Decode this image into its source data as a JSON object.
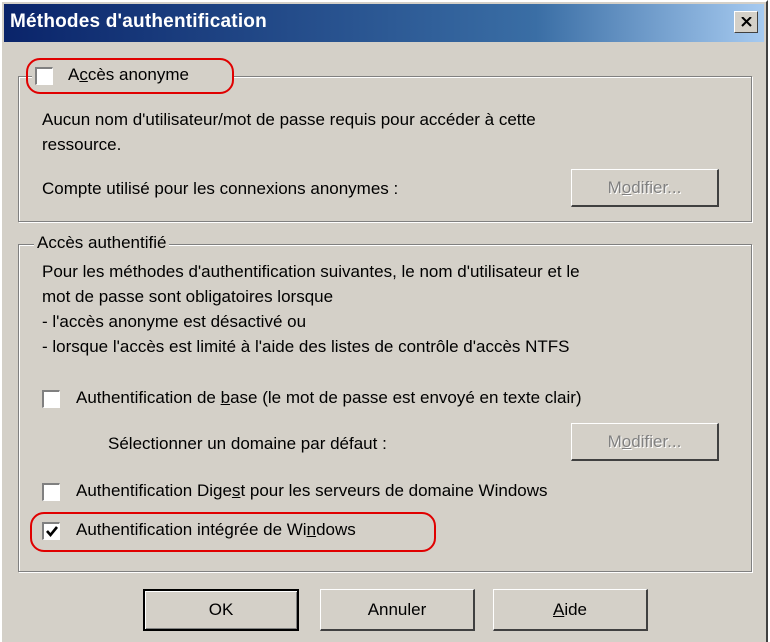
{
  "window": {
    "title": "Méthodes d'authentification",
    "close_label": "×"
  },
  "anonymous": {
    "checkbox_label_pre": "A",
    "checkbox_label_u": "c",
    "checkbox_label_post": "cès anonyme",
    "checked": false,
    "description": "Aucun nom d'utilisateur/mot de passe requis pour accéder à cette",
    "description_line2": "ressource.",
    "account_label": "Compte utilisé pour les connexions anonymes :",
    "modify_pre": "M",
    "modify_u": "o",
    "modify_post": "difier..."
  },
  "authenticated": {
    "legend": "Accès authentifié",
    "intro_lines": [
      "Pour les méthodes d'authentification suivantes, le nom d'utilisateur et le",
      "mot de passe sont obligatoires lorsque",
      "- l'accès anonyme est désactivé ou",
      "- lorsque l'accès est limité à l'aide des listes de contrôle d'accès NTFS"
    ],
    "basic": {
      "label_pre": "Authentification de ",
      "label_u": "b",
      "label_post": "ase (le mot de passe est envoyé en texte clair)",
      "checked": false
    },
    "domain_label": "Sélectionner un domaine par défaut :",
    "modify2_pre": "M",
    "modify2_u": "o",
    "modify2_post": "difier...",
    "digest": {
      "label_pre": "Authentification Dige",
      "label_u": "s",
      "label_post": "t pour les serveurs de domaine Windows",
      "checked": false
    },
    "integrated": {
      "label_pre": "Authentification intégrée de Wi",
      "label_u": "n",
      "label_post": "dows",
      "checked": true
    }
  },
  "buttons": {
    "ok": "OK",
    "cancel": "Annuler",
    "help_u": "A",
    "help_post": "ide"
  },
  "colors": {
    "dialog_bg": "#d4d0c8",
    "title_gradient_start": "#0a246a",
    "highlight": "#e00000"
  }
}
